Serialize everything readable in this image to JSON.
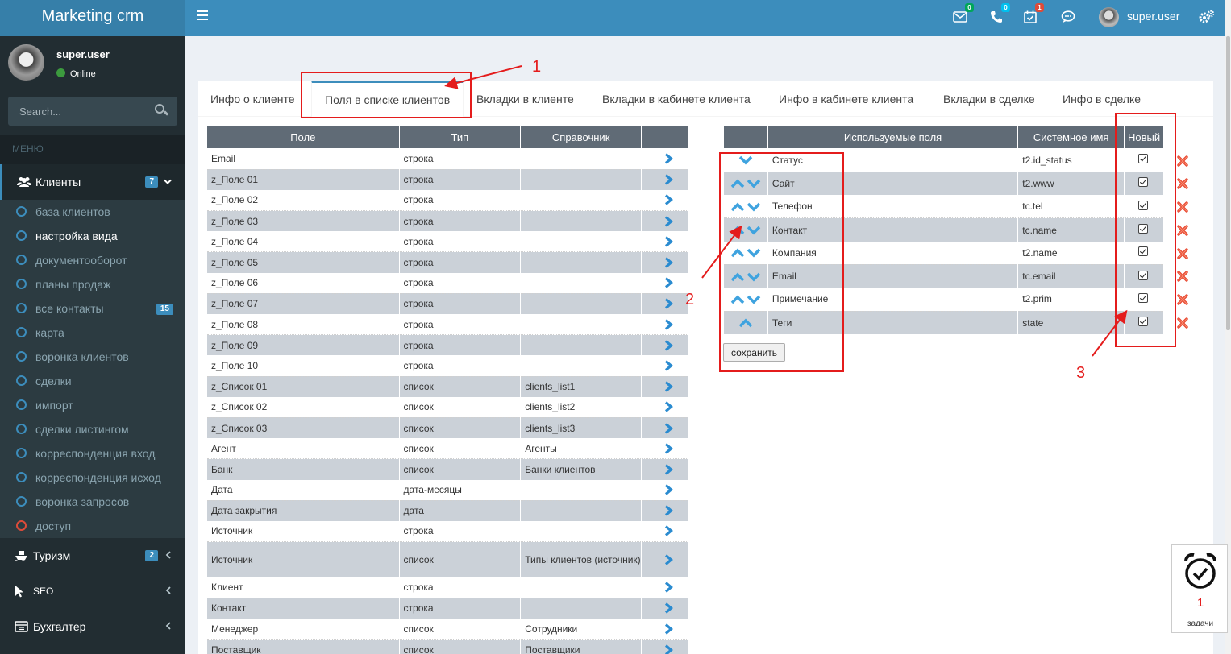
{
  "app": {
    "title": "Marketing crm"
  },
  "topbar": {
    "mail_badge": "0",
    "phone_badge": "0",
    "tasks_badge": "1",
    "username": "super.user",
    "colors": {
      "bar": "#3c8dbc",
      "logo": "#367fa9"
    }
  },
  "user": {
    "name": "super.user",
    "status": "Online"
  },
  "search": {
    "placeholder": "Search..."
  },
  "sidebar": {
    "menu_header": "МЕНЮ",
    "groups": [
      {
        "label": "Клиенты",
        "badge": "7",
        "icon": "users-icon"
      },
      {
        "label": "Туризм",
        "badge": "2",
        "icon": "ship-icon"
      },
      {
        "label": "SEO",
        "icon": "cursor-icon"
      },
      {
        "label": "Бухгалтер",
        "icon": "calculator-icon"
      }
    ],
    "subitems": [
      {
        "label": "база клиентов"
      },
      {
        "label": "настройка вида"
      },
      {
        "label": "документооборот"
      },
      {
        "label": "планы продаж"
      },
      {
        "label": "все контакты",
        "badge": "15"
      },
      {
        "label": "карта"
      },
      {
        "label": "воронка клиентов"
      },
      {
        "label": "сделки"
      },
      {
        "label": "импорт"
      },
      {
        "label": "сделки листингом"
      },
      {
        "label": "корреспонденция вход"
      },
      {
        "label": "корреспонденция исход"
      },
      {
        "label": "воронка запросов"
      },
      {
        "label": "доступ"
      }
    ]
  },
  "tabs": [
    "Инфо о клиенте",
    "Поля в списке клиентов",
    "Вкладки в клиенте",
    "Вкладки в кабинете клиента",
    "Инфо в кабинете клиента",
    "Вкладки в сделке",
    "Инфо в сделке"
  ],
  "left_table": {
    "headers": [
      "Поле",
      "Тип",
      "Справочник"
    ],
    "rows": [
      [
        "Email",
        "строка",
        ""
      ],
      [
        "z_Поле 01",
        "строка",
        ""
      ],
      [
        "z_Поле 02",
        "строка",
        ""
      ],
      [
        "z_Поле 03",
        "строка",
        ""
      ],
      [
        "z_Поле 04",
        "строка",
        ""
      ],
      [
        "z_Поле 05",
        "строка",
        ""
      ],
      [
        "z_Поле 06",
        "строка",
        ""
      ],
      [
        "z_Поле 07",
        "строка",
        ""
      ],
      [
        "z_Поле 08",
        "строка",
        ""
      ],
      [
        "z_Поле 09",
        "строка",
        ""
      ],
      [
        "z_Поле 10",
        "строка",
        ""
      ],
      [
        "z_Список 01",
        "список",
        "clients_list1"
      ],
      [
        "z_Список 02",
        "список",
        "clients_list2"
      ],
      [
        "z_Список 03",
        "список",
        "clients_list3"
      ],
      [
        "Агент",
        "список",
        "Агенты"
      ],
      [
        "Банк",
        "список",
        "Банки клиентов"
      ],
      [
        "Дата",
        "дата-месяцы",
        ""
      ],
      [
        "Дата закрытия",
        "дата",
        ""
      ],
      [
        "Источник",
        "строка",
        ""
      ],
      [
        "Источник",
        "список",
        "Типы клиентов (источник)"
      ],
      [
        "Клиент",
        "строка",
        ""
      ],
      [
        "Контакт",
        "строка",
        ""
      ],
      [
        "Менеджер",
        "список",
        "Сотрудники"
      ],
      [
        "Поставщик",
        "список",
        "Поставщики"
      ]
    ]
  },
  "right_table": {
    "headers": [
      "Используемые поля",
      "Системное имя",
      "Новый"
    ],
    "rows": [
      {
        "field": "Статус",
        "sys": "t2.id_status",
        "up": false,
        "down": true,
        "checked": true
      },
      {
        "field": "Сайт",
        "sys": "t2.www",
        "up": true,
        "down": true,
        "checked": true
      },
      {
        "field": "Телефон",
        "sys": "tc.tel",
        "up": true,
        "down": true,
        "checked": true
      },
      {
        "field": "Контакт",
        "sys": "tc.name",
        "up": true,
        "down": true,
        "checked": true
      },
      {
        "field": "Компания",
        "sys": "t2.name",
        "up": true,
        "down": true,
        "checked": true
      },
      {
        "field": "Email",
        "sys": "tc.email",
        "up": true,
        "down": true,
        "checked": true
      },
      {
        "field": "Примечание",
        "sys": "t2.prim",
        "up": true,
        "down": true,
        "checked": true
      },
      {
        "field": "Теги",
        "sys": "state",
        "up": true,
        "down": false,
        "checked": true
      }
    ],
    "save_label": "сохранить"
  },
  "annotations": [
    "1",
    "2",
    "3"
  ],
  "tasks_widget": {
    "count": "1",
    "label": "задачи"
  }
}
